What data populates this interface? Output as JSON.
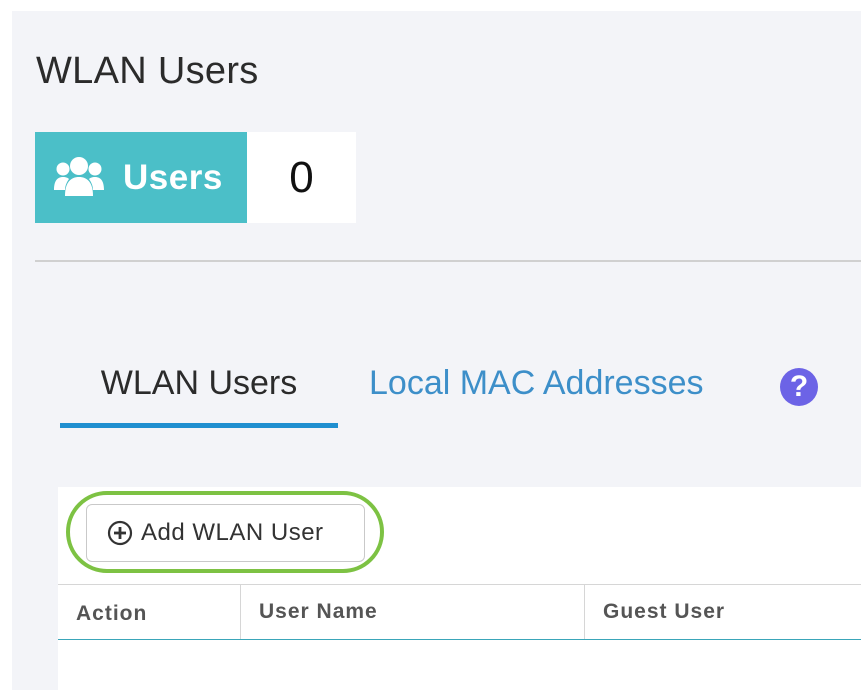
{
  "page": {
    "title": "WLAN Users"
  },
  "stat_tile": {
    "icon": "users-icon",
    "label": "Users",
    "value": "0",
    "accent_color": "#4bbfc8"
  },
  "tabs": [
    {
      "label": "WLAN Users",
      "active": true
    },
    {
      "label": "Local MAC Addresses",
      "active": false
    }
  ],
  "help_icon": {
    "icon": "question-circle-icon",
    "glyph": "?",
    "color": "#6c63e6"
  },
  "toolbar": {
    "add_button_label": "Add WLAN User",
    "add_button_icon": "plus-circle-icon",
    "highlight_color": "#7dc243"
  },
  "table": {
    "columns": [
      "Action",
      "User Name",
      "Guest User"
    ],
    "rows": []
  }
}
